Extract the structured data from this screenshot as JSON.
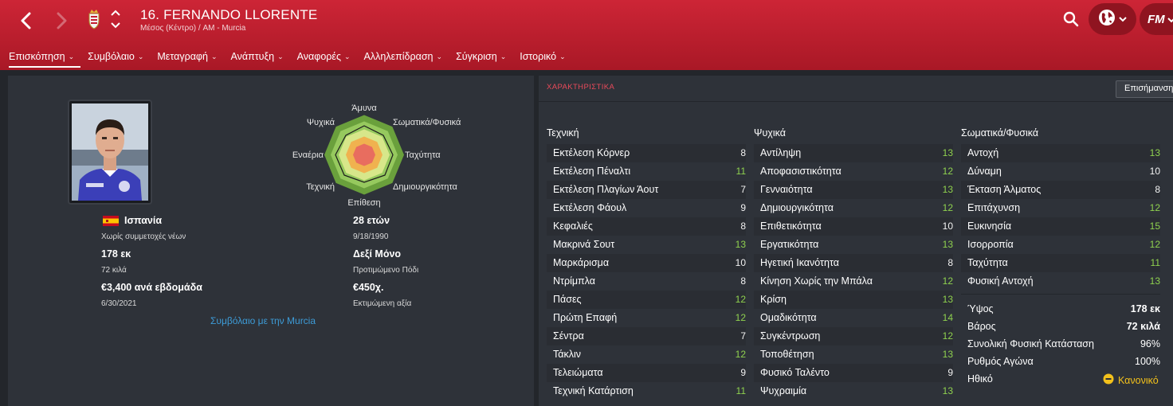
{
  "header": {
    "player_title": "16. FERNANDO LLORENTE",
    "player_sub": "Μέσος (Κέντρο) / AM - Murcia",
    "fm_label": "FM"
  },
  "tabs": [
    {
      "label": "Επισκόπηση",
      "active": true
    },
    {
      "label": "Συμβόλαιο"
    },
    {
      "label": "Μεταγραφή"
    },
    {
      "label": "Ανάπτυξη"
    },
    {
      "label": "Αναφορές"
    },
    {
      "label": "Αλληλεπίδραση"
    },
    {
      "label": "Σύγκριση"
    },
    {
      "label": "Ιστορικό"
    }
  ],
  "overview": {
    "radar_labels": [
      "Άμυνα",
      "Σωματικά/Φυσικά",
      "Ταχύτητα",
      "Δημιουργικότητα",
      "Επίθεση",
      "Τεχνική",
      "Εναέρια",
      "Ψυχικά"
    ],
    "nationality": "Ισπανία",
    "youth_caps": "Χωρίς συμμετοχές νέων",
    "height": "178 εκ",
    "weight": "72 κιλά",
    "wage": "€3,400 ανά εβδομάδα",
    "contract_end": "6/30/2021",
    "age": "28 ετών",
    "dob": "9/18/1990",
    "foot": "Δεξί Μόνο",
    "foot_label": "Προτιμώμενο Πόδι",
    "value": "€450χ.",
    "value_label": "Εκτιμώμενη αξία",
    "contract_link": "Συμβόλαιο με την Murcia"
  },
  "attributes": {
    "heading": "ΧΑΡΑΚΤΗΡΙΣΤΙΚΑ",
    "highlight_button": "Επισήμανση",
    "technical_title": "Τεχνική",
    "technical": [
      {
        "name": "Εκτέλεση Κόρνερ",
        "value": "8"
      },
      {
        "name": "Εκτέλεση Πέναλτι",
        "value": "11"
      },
      {
        "name": "Εκτέλεση Πλαγίων Άουτ",
        "value": "7"
      },
      {
        "name": "Εκτέλεση Φάουλ",
        "value": "9"
      },
      {
        "name": "Κεφαλιές",
        "value": "8"
      },
      {
        "name": "Μακρινά Σουτ",
        "value": "13"
      },
      {
        "name": "Μαρκάρισμα",
        "value": "10"
      },
      {
        "name": "Ντρίμπλα",
        "value": "8"
      },
      {
        "name": "Πάσες",
        "value": "12"
      },
      {
        "name": "Πρώτη Επαφή",
        "value": "12"
      },
      {
        "name": "Σέντρα",
        "value": "7"
      },
      {
        "name": "Τάκλιν",
        "value": "12"
      },
      {
        "name": "Τελειώματα",
        "value": "9"
      },
      {
        "name": "Τεχνική Κατάρτιση",
        "value": "11"
      }
    ],
    "mental_title": "Ψυχικά",
    "mental": [
      {
        "name": "Αντίληψη",
        "value": "13"
      },
      {
        "name": "Αποφασιστικότητα",
        "value": "12"
      },
      {
        "name": "Γενναιότητα",
        "value": "13"
      },
      {
        "name": "Δημιουργικότητα",
        "value": "12"
      },
      {
        "name": "Επιθετικότητα",
        "value": "10"
      },
      {
        "name": "Εργατικότητα",
        "value": "13"
      },
      {
        "name": "Ηγετική Ικανότητα",
        "value": "8"
      },
      {
        "name": "Κίνηση Χωρίς την Μπάλα",
        "value": "12"
      },
      {
        "name": "Κρίση",
        "value": "13"
      },
      {
        "name": "Ομαδικότητα",
        "value": "14"
      },
      {
        "name": "Συγκέντρωση",
        "value": "12"
      },
      {
        "name": "Τοποθέτηση",
        "value": "13"
      },
      {
        "name": "Φυσικό Ταλέντο",
        "value": "9"
      },
      {
        "name": "Ψυχραιμία",
        "value": "13"
      }
    ],
    "physical_title": "Σωματικά/Φυσικά",
    "physical": [
      {
        "name": "Αντοχή",
        "value": "13"
      },
      {
        "name": "Δύναμη",
        "value": "10"
      },
      {
        "name": "Έκταση Άλματος",
        "value": "8"
      },
      {
        "name": "Επιτάχυνση",
        "value": "12"
      },
      {
        "name": "Ευκινησία",
        "value": "15"
      },
      {
        "name": "Ισορροπία",
        "value": "12"
      },
      {
        "name": "Ταχύτητα",
        "value": "11"
      },
      {
        "name": "Φυσική Αντοχή",
        "value": "13"
      }
    ],
    "stats": [
      {
        "name": "Ύψος",
        "value": "178 εκ",
        "bold": true
      },
      {
        "name": "Βάρος",
        "value": "72 κιλά",
        "bold": true
      },
      {
        "name": "Συνολική Φυσική Κατάσταση",
        "value": "96%"
      },
      {
        "name": "Ρυθμός Αγώνα",
        "value": "100%"
      }
    ],
    "morale_label": "Ηθικό",
    "morale_value": "Κανονικό"
  },
  "colors": {
    "header_red": "#c41f30",
    "attr_green": "#8fd14f",
    "link_blue": "#3d9cd8",
    "morale_yellow": "#f3c11b"
  }
}
